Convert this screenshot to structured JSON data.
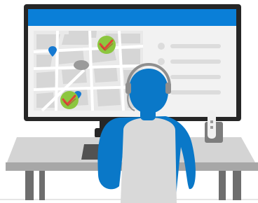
{
  "scene": {
    "subject": "person-at-computer-monitoring-map",
    "colors": {
      "background": "#ffffff",
      "ground_line": "#e6e6e6",
      "monitor_frame": "#262626",
      "monitor_screen": "#f2f2f2",
      "title_bar": "#0a7fd8",
      "map_base": "#e9e9e9",
      "map_blocks": "#d6d6d6",
      "map_roads": "#ffffff",
      "list_lines": "#dcdcdc",
      "pin": "#1679d1",
      "marker_fill": "#8cc63f",
      "marker_check": "#e0453a",
      "person_shirt": "#0a78c8",
      "person_hair": "#0a78c8",
      "chair": "#d9d9d9",
      "desk_top": "#d4d4d4",
      "desk_front": "#a7a7a7",
      "desk_legs": "#6e6e6e",
      "phone_body": "#7d7d7d",
      "phone_handset": "#f0f0f0",
      "keyboard": "#525252",
      "headset": "#8f8f8f"
    },
    "icons": {
      "location_pin": "map-pin-icon",
      "status_marker": "check-badge-icon",
      "list_bullet": "circle-bullet-icon"
    }
  }
}
